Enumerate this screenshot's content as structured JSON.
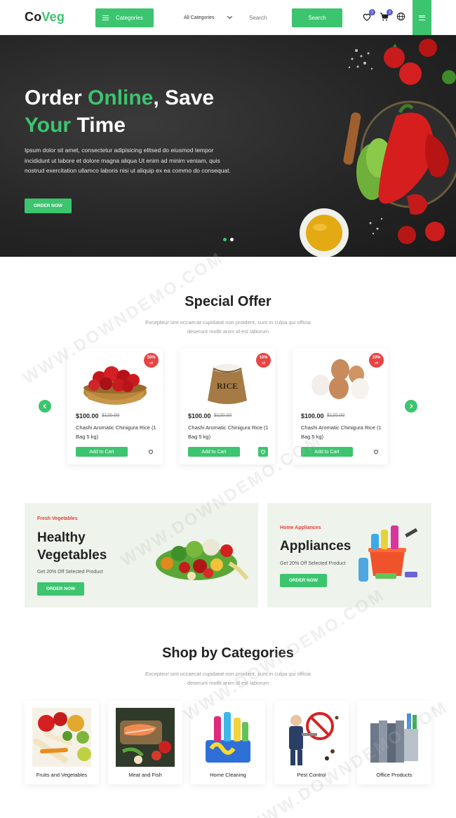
{
  "header": {
    "logo_dark": "Co",
    "logo_accent": "Veg",
    "categories_label": "Categories",
    "all_categories": "All Categories",
    "search_placeholder": "Search",
    "search_label": "Search",
    "wishlist_count": "2",
    "cart_count": "2",
    "icons": [
      "heart-icon",
      "cart-icon",
      "globe-icon",
      "menu-icon"
    ],
    "accent_color": "#3cc46f"
  },
  "hero": {
    "title_part1": "Order ",
    "title_green1": "Online",
    "title_part2": ", Save",
    "title_green2": "Your",
    "title_part3": " Time",
    "text": "Ipsum dolor sit amet, consectetur adipisicing elitsed do eiusmod tempor incididunt ut labore et dolore magna aliqua Ut enim ad minim veniam, quis nostrud exercitation ullamco laboris nisi ut aliquip ex ea commo do consequat.",
    "button": "ORDER NOW",
    "slide_active": 1,
    "slide_count": 2
  },
  "special_offer": {
    "title": "Special Offer",
    "subtitle": "Excepteur sint occaecat cupidatat non proident, sunt in culpa qui officia deserunt mollit anim id est laborum",
    "products": [
      {
        "discount": "10%",
        "discount_suffix": "off",
        "price": "$100.00",
        "old_price": "$120.00",
        "name": "Chashi Aromatic Chinigura Rice (1 Bag 5 kg)",
        "button": "Add to Cart",
        "image": "apples-basket",
        "wishlist_active": false
      },
      {
        "discount": "10%",
        "discount_suffix": "off",
        "price": "$100.00",
        "old_price": "$120.00",
        "name": "Chashi Aromatic Chinigura Rice (1 Bag 5 kg)",
        "button": "Add to Cart",
        "image": "rice-sack",
        "sack_label": "RICE",
        "wishlist_active": true
      },
      {
        "discount": "10%",
        "discount_suffix": "off",
        "price": "$100.00",
        "old_price": "$120.00",
        "name": "Chashi Aromatic Chinigura Rice (1 Bag 5 kg)",
        "button": "Add to Cart",
        "image": "eggs",
        "wishlist_active": false
      }
    ]
  },
  "banners": [
    {
      "tag": "Fresh Vegetables",
      "title_line1": "Healthy",
      "title_line2": "Vegetables",
      "subtitle": "Get 20% Off Selected Product",
      "button": "ORDER NOW"
    },
    {
      "tag": "Home Appliances",
      "title_line1": "Appliances",
      "subtitle": "Get 20% Off Selected Product",
      "button": "ORDER NOW"
    }
  ],
  "shop_categories": {
    "title": "Shop by Categories",
    "subtitle": "Excepteur sint occaecat cupidatat non proident, sunt in culpa qui officia deserunt mollit anim id est laborum",
    "items": [
      {
        "label": "Fruits and Vegetables"
      },
      {
        "label": "Meat and Fish"
      },
      {
        "label": "Home Cleaning"
      },
      {
        "label": "Pest Control"
      },
      {
        "label": "Office Products"
      }
    ]
  },
  "watermark": "WWW.DOWNDEMO.COM"
}
